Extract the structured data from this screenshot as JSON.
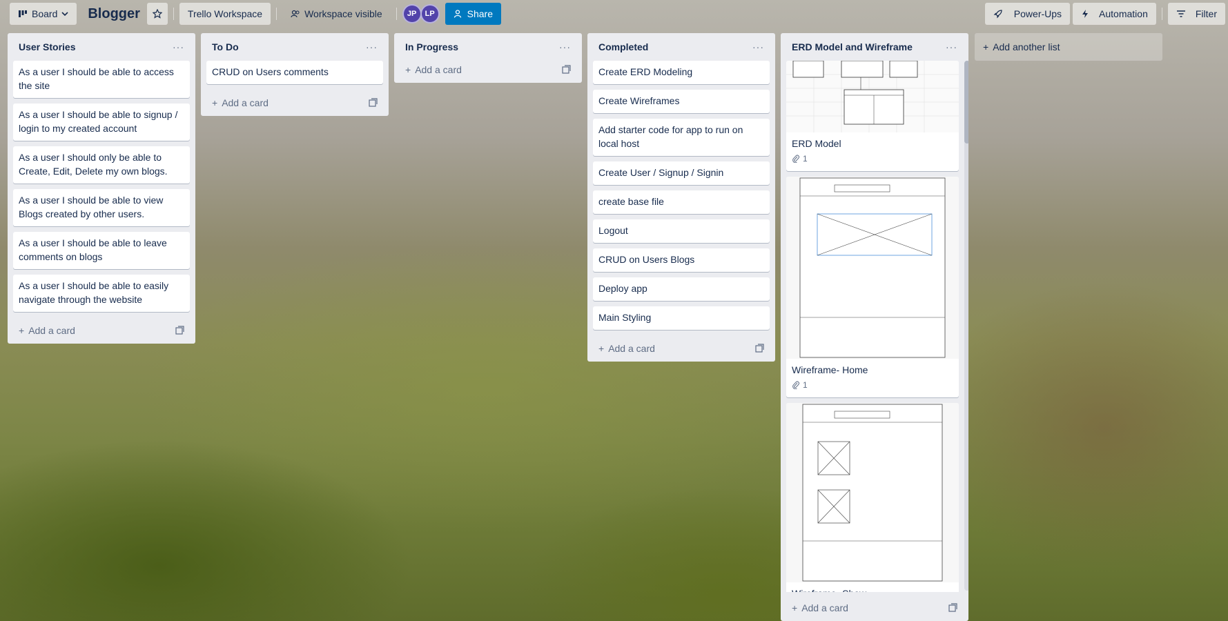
{
  "topbar": {
    "board_view": "Board",
    "board_title": "Blogger",
    "workspace": "Trello Workspace",
    "visibility": "Workspace visible",
    "avatars": [
      "JP",
      "LP"
    ],
    "share": "Share",
    "power_ups": "Power-Ups",
    "automation": "Automation",
    "filter": "Filter"
  },
  "lists": [
    {
      "title": "User Stories",
      "cards": [
        "As a user I should be able to access the site",
        "As a user I should be able to signup / login to my created account",
        "As a user I should only be able to Create, Edit, Delete my own blogs.",
        "As a user I should be able to view Blogs created by other users.",
        "As a user I should be able to leave comments on blogs",
        "As a user I should be able to easily navigate through the website"
      ],
      "add_card": "Add a card"
    },
    {
      "title": "To Do",
      "cards": [
        "CRUD on Users comments"
      ],
      "add_card": "Add a card"
    },
    {
      "title": "In Progress",
      "cards": [],
      "add_card": "Add a card"
    },
    {
      "title": "Completed",
      "cards": [
        "Create ERD Modeling",
        "Create Wireframes",
        "Add starter code for app to run on local host",
        "Create User / Signup / Signin",
        "create base file",
        "Logout",
        "CRUD on Users Blogs",
        "Deploy app",
        "Main Styling"
      ],
      "add_card": "Add a card"
    },
    {
      "title": "ERD Model and Wireframe",
      "cards": [
        {
          "title": "ERD Model",
          "attachments": "1"
        },
        {
          "title": "Wireframe- Home",
          "attachments": "1"
        },
        {
          "title": "Wireframe- Show",
          "attachments": ""
        }
      ],
      "add_card": "Add a card"
    }
  ],
  "add_list": "Add another list",
  "icons": {
    "board": "board-icon",
    "star": "star-icon",
    "people": "people-icon",
    "share": "person-add-icon",
    "power_ups": "rocket-icon",
    "automation": "lightning-icon",
    "filter": "filter-icon",
    "plus": "plus-icon",
    "template": "template-icon",
    "attachment": "paperclip-icon"
  },
  "colors": {
    "list_bg": "#ebecf0",
    "share": "#0079bf",
    "avatar": "#5243aa"
  }
}
